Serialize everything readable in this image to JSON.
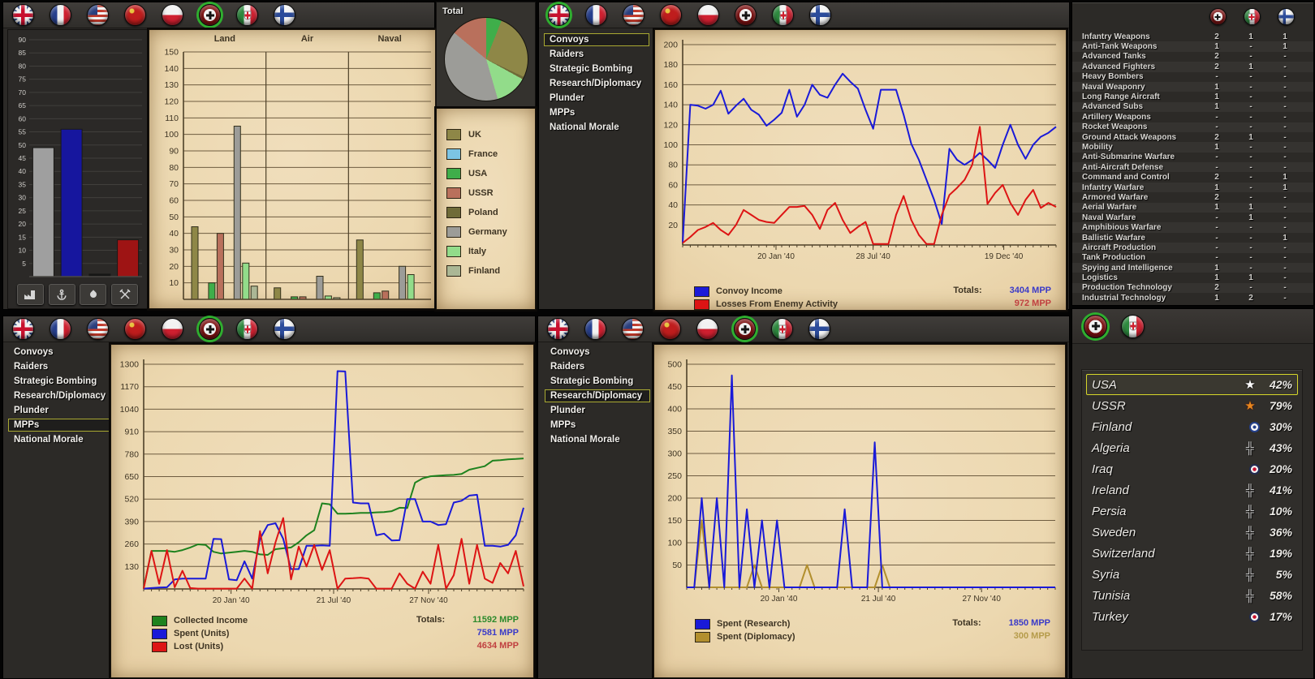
{
  "nations": [
    "UK",
    "France",
    "USA",
    "USSR",
    "Poland",
    "Germany",
    "Italy",
    "Finland"
  ],
  "nation_colors": [
    "#8e8747",
    "#7cc4e4",
    "#3fae4a",
    "#b9705c",
    "#6f6b38",
    "#9c9c98",
    "#92dc8a",
    "#abb795"
  ],
  "overview": {
    "flags": {
      "items": [
        "UK",
        "France",
        "USA",
        "USSR",
        "Poland",
        "Germany",
        "Italy",
        "Finland"
      ],
      "selected": 5
    },
    "mini_chart": {
      "type": "bar",
      "ymax": 90,
      "yticks": [
        5,
        10,
        15,
        20,
        25,
        30,
        35,
        40,
        45,
        50,
        55,
        60,
        65,
        70,
        75,
        80,
        85,
        90
      ],
      "values": [
        49,
        56,
        1,
        14
      ],
      "colors": [
        "#9f9f9f",
        "#16169e",
        "#151515",
        "#9e1414"
      ]
    },
    "resource_buttons": [
      "industry",
      "ports",
      "oil",
      "mines"
    ],
    "force_chart": {
      "type": "grouped-bar",
      "ymax": 150,
      "yticks": [
        10,
        20,
        30,
        40,
        50,
        60,
        70,
        80,
        90,
        100,
        110,
        120,
        130,
        140,
        150
      ],
      "colors": [
        "#8e8747",
        "#7cc4e4",
        "#3fae4a",
        "#b9705c",
        "#6f6b38",
        "#9c9c98",
        "#92dc8a",
        "#abb795"
      ],
      "sections": [
        {
          "label": "Land",
          "values": [
            44,
            0,
            10,
            40,
            0,
            105,
            22,
            8
          ]
        },
        {
          "label": "Air",
          "values": [
            7,
            0,
            1.5,
            1.5,
            0,
            14,
            2,
            1
          ]
        },
        {
          "label": "Naval",
          "values": [
            36,
            0,
            4,
            5,
            0,
            20,
            15,
            0
          ]
        }
      ]
    },
    "pie": {
      "type": "pie",
      "title": "Total",
      "slices": [
        {
          "name": "USA",
          "value": 6,
          "color": "#3fae4a"
        },
        {
          "name": "UK",
          "value": 26,
          "color": "#8e8747"
        },
        {
          "name": "Poland",
          "value": 1,
          "color": "#6f6b38"
        },
        {
          "name": "Italy",
          "value": 12.5,
          "color": "#92dc8a"
        },
        {
          "name": "Germany",
          "value": 40.5,
          "color": "#9c9c98"
        },
        {
          "name": "USSR",
          "value": 14,
          "color": "#b9705c"
        }
      ]
    },
    "nation_legend": [
      {
        "label": "UK",
        "color": "#8e8747"
      },
      {
        "label": "France",
        "color": "#7cc4e4"
      },
      {
        "label": "USA",
        "color": "#3fae4a"
      },
      {
        "label": "USSR",
        "color": "#b9705c"
      },
      {
        "label": "Poland",
        "color": "#6f6b38"
      },
      {
        "label": "Germany",
        "color": "#9c9c98"
      },
      {
        "label": "Italy",
        "color": "#92dc8a"
      },
      {
        "label": "Finland",
        "color": "#abb795"
      }
    ]
  },
  "convoys_panel": {
    "flags": {
      "items": [
        "UK",
        "France",
        "USA",
        "USSR",
        "Poland",
        "Germany",
        "Italy",
        "Finland"
      ],
      "selected": 0
    },
    "menu": {
      "items": [
        "Convoys",
        "Raiders",
        "Strategic Bombing",
        "Research/Diplomacy",
        "Plunder",
        "MPPs",
        "National Morale"
      ],
      "selected": 0
    },
    "chart_data": {
      "type": "line",
      "ymax": 200,
      "yticks": [
        20,
        40,
        60,
        80,
        100,
        120,
        140,
        160,
        180,
        200
      ],
      "xlabels": [
        {
          "text": "20 Jan '40",
          "pos": 0.25
        },
        {
          "text": "28 Jul '40",
          "pos": 0.51
        },
        {
          "text": "19 Dec '40",
          "pos": 0.86
        }
      ],
      "series": [
        {
          "name": "Convoy Income",
          "color": "#1a1ad8",
          "values": [
            2,
            140,
            139,
            136,
            140,
            154,
            131,
            139,
            146,
            135,
            130,
            119,
            125,
            132,
            155,
            128,
            140,
            160,
            150,
            147,
            160,
            171,
            163,
            156,
            135,
            116,
            155,
            155,
            155,
            130,
            101,
            85,
            65,
            45,
            21,
            96,
            85,
            80,
            85,
            92,
            85,
            77,
            100,
            120,
            100,
            86,
            100,
            108,
            112,
            118
          ]
        },
        {
          "name": "Losses From Enemy Activity",
          "color": "#dd1414",
          "values": [
            2,
            8,
            15,
            18,
            22,
            15,
            10,
            20,
            35,
            30,
            25,
            23,
            22,
            30,
            38,
            38,
            39,
            30,
            16,
            35,
            42,
            25,
            12,
            18,
            23,
            1,
            1,
            1,
            30,
            49,
            25,
            10,
            1,
            1,
            30,
            50,
            57,
            65,
            80,
            118,
            41,
            52,
            60,
            42,
            30,
            45,
            55,
            37,
            42,
            38
          ]
        }
      ]
    },
    "legend": {
      "totals_label": "Totals:",
      "rows": [
        {
          "label": "Convoy Income",
          "color": "#1a1ad8",
          "total": "3404 MPP",
          "total_color": "#3a3ac8"
        },
        {
          "label": "Losses From Enemy Activity",
          "color": "#dd1414",
          "total": "972 MPP",
          "total_color": "#c04040"
        }
      ]
    }
  },
  "mpp_panel": {
    "flags": {
      "items": [
        "UK",
        "France",
        "USA",
        "USSR",
        "Poland",
        "Germany",
        "Italy",
        "Finland"
      ],
      "selected": 5
    },
    "menu": {
      "items": [
        "Convoys",
        "Raiders",
        "Strategic Bombing",
        "Research/Diplomacy",
        "Plunder",
        "MPPs",
        "National Morale"
      ],
      "selected": 5
    },
    "chart_data": {
      "type": "line",
      "ymax": 1300,
      "yticks": [
        130,
        260,
        390,
        520,
        650,
        780,
        910,
        1040,
        1170,
        1300
      ],
      "xlabels": [
        {
          "text": "20 Jan '40",
          "pos": 0.23
        },
        {
          "text": "21 Jul '40",
          "pos": 0.5
        },
        {
          "text": "27 Nov '40",
          "pos": 0.75
        }
      ],
      "series": [
        {
          "name": "Collected Income",
          "color": "#1e821e",
          "values": [
            5,
            220,
            220,
            220,
            215,
            225,
            240,
            258,
            255,
            215,
            205,
            210,
            215,
            220,
            215,
            200,
            197,
            230,
            235,
            240,
            270,
            310,
            340,
            495,
            490,
            435,
            435,
            437,
            440,
            440,
            443,
            445,
            450,
            470,
            468,
            615,
            640,
            652,
            655,
            658,
            660,
            665,
            690,
            700,
            710,
            742,
            745,
            750,
            752,
            755
          ]
        },
        {
          "name": "Spent (Units)",
          "color": "#1a1ad8",
          "values": [
            2,
            5,
            8,
            10,
            55,
            60,
            60,
            60,
            60,
            290,
            288,
            55,
            50,
            160,
            60,
            290,
            370,
            380,
            290,
            115,
            115,
            250,
            250,
            252,
            250,
            1260,
            1258,
            500,
            495,
            495,
            310,
            320,
            280,
            282,
            520,
            520,
            390,
            390,
            370,
            375,
            500,
            510,
            540,
            545,
            250,
            250,
            245,
            255,
            310,
            470
          ]
        },
        {
          "name": "Lost (Units)",
          "color": "#dd1414",
          "values": [
            2,
            220,
            30,
            225,
            10,
            105,
            5,
            2,
            2,
            2,
            2,
            2,
            2,
            60,
            2,
            335,
            90,
            270,
            410,
            55,
            245,
            130,
            255,
            110,
            225,
            2,
            60,
            62,
            65,
            60,
            2,
            2,
            2,
            90,
            30,
            2,
            100,
            30,
            255,
            2,
            80,
            290,
            30,
            255,
            60,
            35,
            150,
            90,
            220,
            15
          ]
        }
      ]
    },
    "legend": {
      "totals_label": "Totals:",
      "rows": [
        {
          "label": "Collected Income",
          "color": "#1e821e",
          "total": "11592 MPP",
          "total_color": "#2c8a2c"
        },
        {
          "label": "Spent (Units)",
          "color": "#1a1ad8",
          "total": "7581 MPP",
          "total_color": "#3a3ac8"
        },
        {
          "label": "Lost (Units)",
          "color": "#dd1414",
          "total": "4634 MPP",
          "total_color": "#c04040"
        }
      ]
    }
  },
  "research_panel": {
    "flags": {
      "items": [
        "UK",
        "France",
        "USA",
        "USSR",
        "Poland",
        "Germany",
        "Italy",
        "Finland"
      ],
      "selected": 5
    },
    "menu": {
      "items": [
        "Convoys",
        "Raiders",
        "Strategic Bombing",
        "Research/Diplomacy",
        "Plunder",
        "MPPs",
        "National Morale"
      ],
      "selected": 3
    },
    "chart_data": {
      "type": "line",
      "ymax": 500,
      "yticks": [
        50,
        100,
        150,
        200,
        250,
        300,
        350,
        400,
        450,
        500
      ],
      "xlabels": [
        {
          "text": "20 Jan '40",
          "pos": 0.25
        },
        {
          "text": "21 Jul '40",
          "pos": 0.52
        },
        {
          "text": "27 Nov '40",
          "pos": 0.8
        }
      ],
      "series": [
        {
          "name": "Spent (Diplomacy)",
          "color": "#b28f2e",
          "values": [
            0,
            0,
            150,
            0,
            0,
            0,
            0,
            0,
            0,
            50,
            0,
            0,
            0,
            0,
            0,
            0,
            50,
            0,
            0,
            0,
            0,
            0,
            0,
            0,
            0,
            0,
            50,
            0,
            0,
            0,
            0,
            0,
            0,
            0,
            0,
            0,
            0,
            0,
            0,
            0,
            0,
            0,
            0,
            0,
            0,
            0,
            0,
            0,
            0,
            0
          ]
        },
        {
          "name": "Spent (Research)",
          "color": "#1a1ad8",
          "values": [
            0,
            0,
            200,
            0,
            200,
            0,
            475,
            0,
            175,
            0,
            150,
            0,
            150,
            0,
            0,
            0,
            0,
            0,
            0,
            0,
            0,
            175,
            0,
            0,
            0,
            325,
            0,
            0,
            0,
            0,
            0,
            0,
            0,
            0,
            0,
            0,
            0,
            0,
            0,
            0,
            0,
            0,
            0,
            0,
            0,
            0,
            0,
            0,
            0,
            0
          ]
        }
      ]
    },
    "legend": {
      "totals_label": "Totals:",
      "rows": [
        {
          "label": "Spent (Research)",
          "color": "#1a1ad8",
          "total": "1850 MPP",
          "total_color": "#3a3ac8"
        },
        {
          "label": "Spent (Diplomacy)",
          "color": "#b28f2e",
          "total": "300 MPP",
          "total_color": "#b59b4a"
        }
      ]
    }
  },
  "tech_table": {
    "header_flags": [
      "Germany",
      "Italy",
      "Finland"
    ],
    "rows": [
      {
        "label": "Infantry Weapons",
        "values": [
          "2",
          "1",
          "1"
        ]
      },
      {
        "label": "Anti-Tank Weapons",
        "values": [
          "1",
          "-",
          "1"
        ]
      },
      {
        "label": "Advanced Tanks",
        "values": [
          "2",
          "-",
          "-"
        ]
      },
      {
        "label": "Advanced Fighters",
        "values": [
          "2",
          "1",
          "-"
        ]
      },
      {
        "label": "Heavy Bombers",
        "values": [
          "-",
          "-",
          "-"
        ]
      },
      {
        "label": "Naval Weaponry",
        "values": [
          "1",
          "-",
          "-"
        ]
      },
      {
        "label": "Long Range Aircraft",
        "values": [
          "1",
          "-",
          "-"
        ]
      },
      {
        "label": "Advanced Subs",
        "values": [
          "1",
          "-",
          "-"
        ]
      },
      {
        "label": "Artillery Weapons",
        "values": [
          "-",
          "-",
          "-"
        ]
      },
      {
        "label": "Rocket Weapons",
        "values": [
          "-",
          "-",
          "-"
        ]
      },
      {
        "label": "Ground Attack Weapons",
        "values": [
          "2",
          "1",
          "-"
        ]
      },
      {
        "label": "Mobility",
        "values": [
          "1",
          "-",
          "-"
        ]
      },
      {
        "label": "Anti-Submarine Warfare",
        "values": [
          "-",
          "-",
          "-"
        ]
      },
      {
        "label": "Anti-Aircraft Defense",
        "values": [
          "-",
          "-",
          "-"
        ]
      },
      {
        "label": "Command and Control",
        "values": [
          "2",
          "-",
          "1"
        ]
      },
      {
        "label": "Infantry Warfare",
        "values": [
          "1",
          "-",
          "1"
        ]
      },
      {
        "label": "Armored Warfare",
        "values": [
          "2",
          "-",
          "-"
        ]
      },
      {
        "label": "Aerial Warfare",
        "values": [
          "1",
          "1",
          "-"
        ]
      },
      {
        "label": "Naval Warfare",
        "values": [
          "-",
          "1",
          "-"
        ]
      },
      {
        "label": "Amphibious Warfare",
        "values": [
          "-",
          "-",
          "-"
        ]
      },
      {
        "label": "Ballistic Warfare",
        "values": [
          "-",
          "-",
          "1"
        ]
      },
      {
        "label": "Aircraft Production",
        "values": [
          "-",
          "-",
          "-"
        ]
      },
      {
        "label": "Tank Production",
        "values": [
          "-",
          "-",
          "-"
        ]
      },
      {
        "label": "Spying and Intelligence",
        "values": [
          "1",
          "-",
          "-"
        ]
      },
      {
        "label": "Logistics",
        "values": [
          "1",
          "1",
          "-"
        ]
      },
      {
        "label": "Production Technology",
        "values": [
          "2",
          "-",
          "-"
        ]
      },
      {
        "label": "Industrial Technology",
        "values": [
          "1",
          "2",
          "-"
        ]
      }
    ]
  },
  "diplomacy_panel": {
    "flags": {
      "items": [
        "Germany",
        "Italy"
      ],
      "selected": 0
    },
    "countries": [
      {
        "name": "USA",
        "icon": "star-white",
        "pct": "42%",
        "selected": true
      },
      {
        "name": "USSR",
        "icon": "star-orange",
        "pct": "79%",
        "selected": false
      },
      {
        "name": "Finland",
        "icon": "roundel-blue",
        "pct": "30%",
        "selected": false
      },
      {
        "name": "Algeria",
        "icon": "cross",
        "pct": "43%",
        "selected": false
      },
      {
        "name": "Iraq",
        "icon": "roundel-red",
        "pct": "20%",
        "selected": false
      },
      {
        "name": "Ireland",
        "icon": "cross",
        "pct": "41%",
        "selected": false
      },
      {
        "name": "Persia",
        "icon": "cross",
        "pct": "10%",
        "selected": false
      },
      {
        "name": "Sweden",
        "icon": "cross",
        "pct": "36%",
        "selected": false
      },
      {
        "name": "Switzerland",
        "icon": "cross",
        "pct": "19%",
        "selected": false
      },
      {
        "name": "Syria",
        "icon": "cross",
        "pct": "5%",
        "selected": false
      },
      {
        "name": "Tunisia",
        "icon": "cross",
        "pct": "58%",
        "selected": false
      },
      {
        "name": "Turkey",
        "icon": "roundel-red",
        "pct": "17%",
        "selected": false
      }
    ]
  }
}
